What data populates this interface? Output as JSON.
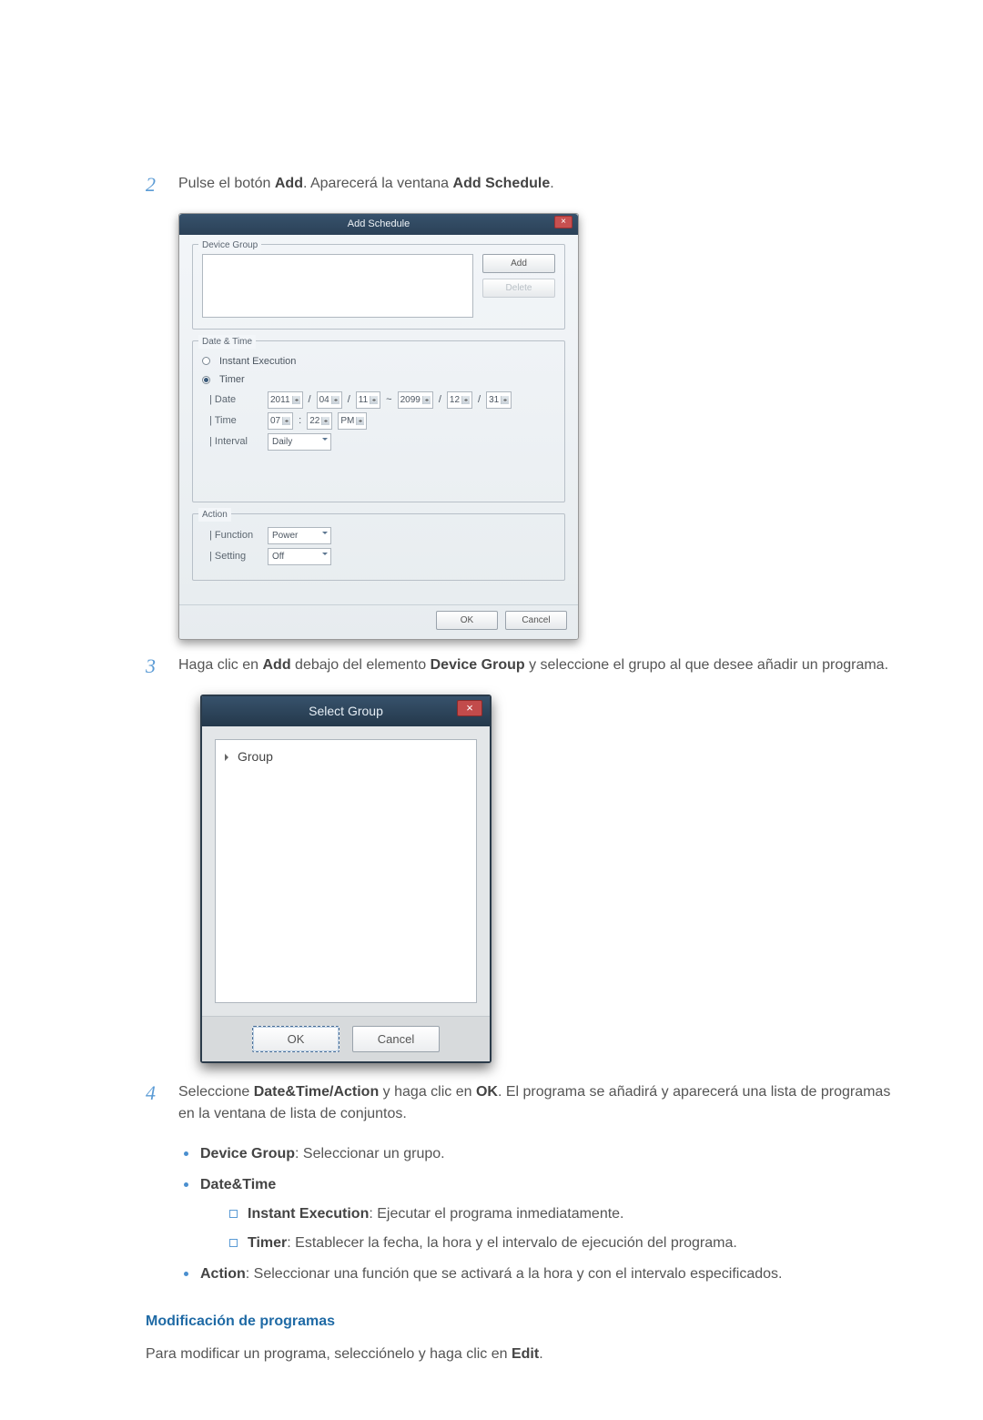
{
  "step2": {
    "num": "2",
    "text_a": "Pulse el botón ",
    "bold_a": "Add",
    "text_b": ". Aparecerá la ventana ",
    "bold_b": "Add Schedule",
    "text_c": "."
  },
  "addSchedule": {
    "title": "Add Schedule",
    "close": "×",
    "deviceGroup": {
      "legend": "Device Group",
      "addBtn": "Add",
      "deleteBtn": "Delete"
    },
    "dateTime": {
      "legend": "Date & Time",
      "instant": "Instant Execution",
      "timer": "Timer",
      "dateLabel": "| Date",
      "dateFrom": {
        "y": "2011",
        "m": "04",
        "d": "11"
      },
      "dateSep1": "/",
      "dateSep2": "/",
      "rangeSep": "~",
      "dateTo": {
        "y": "2099",
        "m": "12",
        "d": "31"
      },
      "timeLabel": "| Time",
      "time": {
        "h": "07",
        "m": "22",
        "ap": "PM"
      },
      "timeSep": ":",
      "intervalLabel": "| Interval",
      "intervalValue": "Daily"
    },
    "action": {
      "legend": "Action",
      "funcLabel": "| Function",
      "funcValue": "Power",
      "settingLabel": "| Setting",
      "settingValue": "Off"
    },
    "ok": "OK",
    "cancel": "Cancel"
  },
  "step3": {
    "num": "3",
    "text_a": "Haga clic en ",
    "bold_a": "Add",
    "text_b": " debajo del elemento ",
    "bold_b": "Device Group",
    "text_c": " y seleccione el grupo al que desee añadir un programa."
  },
  "selectGroup": {
    "title": "Select Group",
    "close": "×",
    "rootItem": "Group",
    "ok": "OK",
    "cancel": "Cancel"
  },
  "step4": {
    "num": "4",
    "text_a": "Seleccione ",
    "bold_a": "Date&Time/Action",
    "text_b": " y haga clic en ",
    "bold_b": "OK",
    "text_c": ". El programa se añadirá y aparecerá una lista de programas en la ventana de lista de conjuntos.",
    "bullets": {
      "devGroup": {
        "label": "Device Group",
        "text": ": Seleccionar un grupo."
      },
      "dateTimeLabel": "Date&Time",
      "instant": {
        "label": "Instant Execution",
        "text": ": Ejecutar el programa inmediatamente."
      },
      "timer": {
        "label": "Timer",
        "text": ": Establecer la fecha, la hora y el intervalo de ejecución del programa."
      },
      "action": {
        "label": "Action",
        "text": ": Seleccionar una función que se activará a la hora y con el intervalo especificados."
      }
    }
  },
  "modSection": {
    "heading": "Modificación de programas",
    "text_a": "Para modificar un programa, selecciónelo y haga clic en ",
    "bold_a": "Edit",
    "text_b": "."
  }
}
